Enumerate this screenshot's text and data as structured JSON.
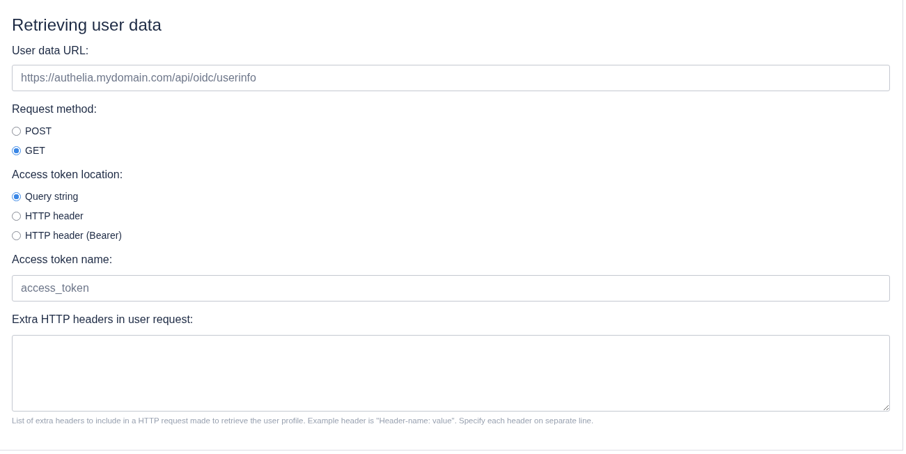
{
  "section": {
    "title": "Retrieving user data"
  },
  "user_data_url": {
    "label": "User data URL:",
    "placeholder": "https://authelia.mydomain.com/api/oidc/userinfo"
  },
  "request_method": {
    "label": "Request method:",
    "options": [
      {
        "label": "POST",
        "selected": false
      },
      {
        "label": "GET",
        "selected": true
      }
    ]
  },
  "access_token_location": {
    "label": "Access token location:",
    "options": [
      {
        "label": "Query string",
        "selected": true
      },
      {
        "label": "HTTP header",
        "selected": false
      },
      {
        "label": "HTTP header (Bearer)",
        "selected": false
      }
    ]
  },
  "access_token_name": {
    "label": "Access token name:",
    "placeholder": "access_token"
  },
  "extra_headers": {
    "label": "Extra HTTP headers in user request:",
    "help": "List of extra headers to include in a HTTP request made to retrieve the user profile. Example header is \"Header-name: value\". Specify each header on separate line."
  }
}
